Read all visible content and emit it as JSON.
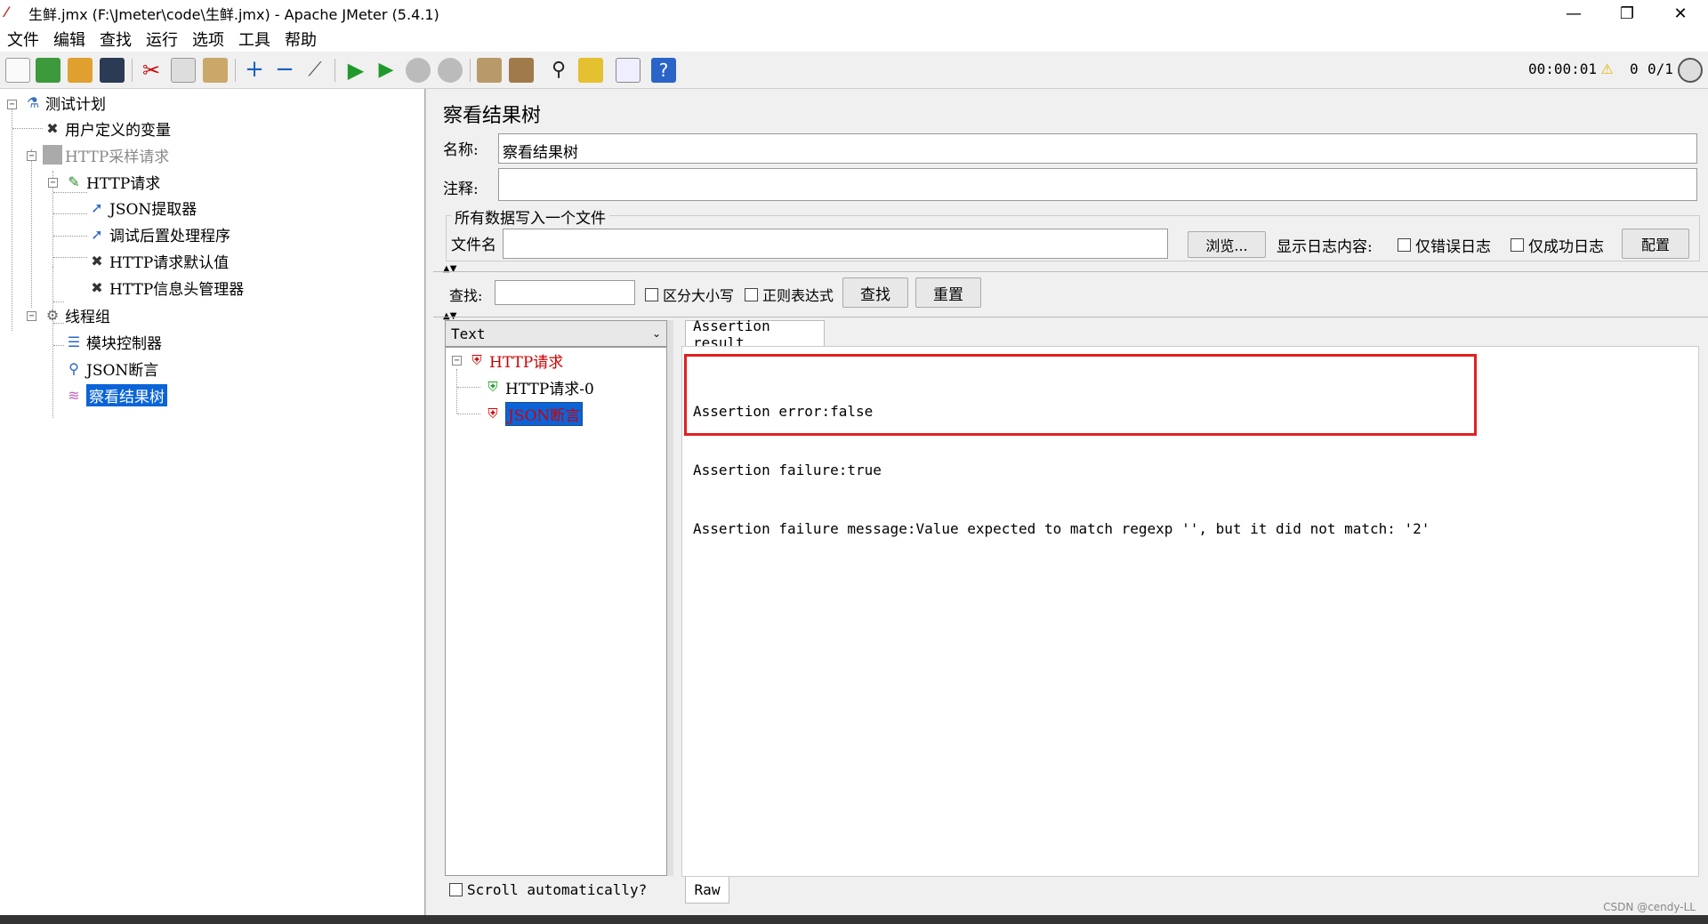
{
  "window": {
    "title": "生鲜.jmx (F:\\Jmeter\\code\\生鲜.jmx) - Apache JMeter (5.4.1)",
    "minimize": "—",
    "restore": "❐",
    "close": "✕"
  },
  "menu": [
    "文件",
    "编辑",
    "查找",
    "运行",
    "选项",
    "工具",
    "帮助"
  ],
  "toolbar": {
    "timer": "00:00:01",
    "warnings": "0",
    "threads": "0/1"
  },
  "tree": [
    {
      "label": "测试计划",
      "icon": "test-plan-icon"
    },
    {
      "label": "用户定义的变量",
      "icon": "wrench-icon"
    },
    {
      "label": "HTTP采样请求",
      "icon": "disabled-sampler-icon"
    },
    {
      "label": "HTTP请求",
      "icon": "pipette-icon"
    },
    {
      "label": "JSON提取器",
      "icon": "postprocessor-icon"
    },
    {
      "label": "调试后置处理程序",
      "icon": "postprocessor-icon"
    },
    {
      "label": "HTTP请求默认值",
      "icon": "wrench-icon"
    },
    {
      "label": "HTTP信息头管理器",
      "icon": "wrench-icon"
    },
    {
      "label": "线程组",
      "icon": "gear-icon"
    },
    {
      "label": "模块控制器",
      "icon": "controller-icon"
    },
    {
      "label": "JSON断言",
      "icon": "magnifier-icon"
    },
    {
      "label": "察看结果树",
      "icon": "chart-icon"
    }
  ],
  "panel": {
    "title": "察看结果树",
    "name_label": "名称:",
    "name_value": "察看结果树",
    "comment_label": "注释:",
    "comment_value": "",
    "file_group_label": "所有数据写入一个文件",
    "filename_label": "文件名",
    "filename_value": "",
    "browse_button": "浏览...",
    "log_label": "显示日志内容:",
    "errors_only": "仅错误日志",
    "success_only": "仅成功日志",
    "configure_button": "配置",
    "search_label": "查找:",
    "search_value": "",
    "case_sensitive": "区分大小写",
    "regex": "正则表达式",
    "find_button": "查找",
    "reset_button": "重置"
  },
  "results": {
    "renderer": "Text",
    "items": [
      {
        "label": "HTTP请求",
        "status": "fail"
      },
      {
        "label": "HTTP请求-0",
        "status": "pass"
      },
      {
        "label": "JSON断言",
        "status": "fail"
      }
    ],
    "scroll_label": "Scroll automatically?",
    "tab_label": "Assertion result",
    "raw_tab": "Raw",
    "assertion_lines": [
      "Assertion error:false",
      "Assertion failure:true",
      "Assertion failure message:Value expected to match regexp '', but it did not match: '2'"
    ]
  },
  "watermark": "CSDN @cendy-LL",
  "colors": {
    "selection": "#0a64d8",
    "highlight_box": "#e02020",
    "fail_text": "#d00000"
  }
}
